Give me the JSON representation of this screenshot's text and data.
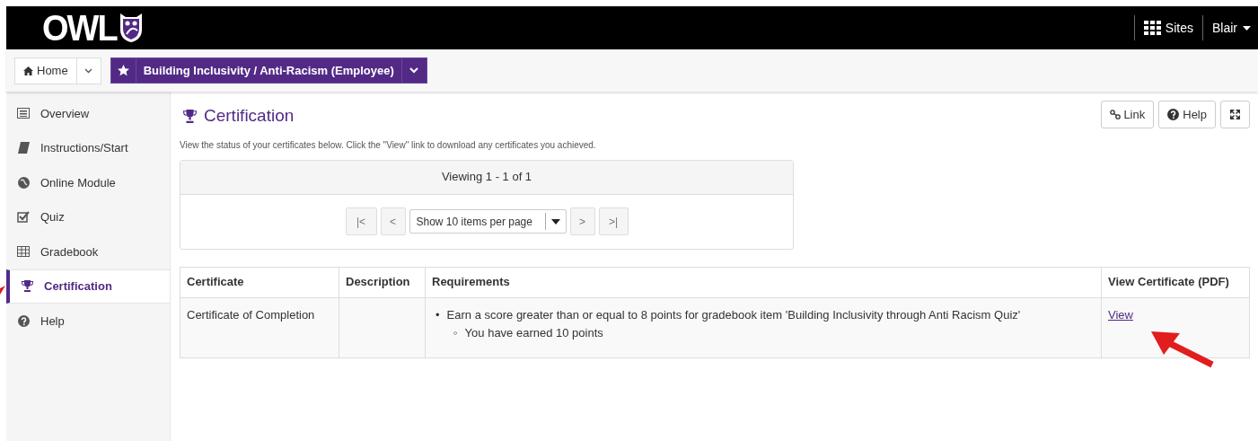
{
  "header": {
    "logo": "OWL",
    "sites": "Sites",
    "user": "Blair"
  },
  "breadcrumb": {
    "home": "Home",
    "site": "Building Inclusivity / Anti-Racism (Employee)"
  },
  "sidebar": {
    "items": [
      {
        "label": "Overview",
        "selected": false
      },
      {
        "label": "Instructions/Start",
        "selected": false
      },
      {
        "label": "Online Module",
        "selected": false
      },
      {
        "label": "Quiz",
        "selected": false
      },
      {
        "label": "Gradebook",
        "selected": false
      },
      {
        "label": "Certification",
        "selected": true
      },
      {
        "label": "Help",
        "selected": false
      }
    ]
  },
  "page": {
    "title": "Certification",
    "buttons": [
      "Link",
      "Help"
    ],
    "intro": "View the status of your certificates below. Click the \"View\" link to download any certificates you achieved."
  },
  "pager": {
    "status": "Viewing 1 - 1 of 1",
    "first": "|<",
    "prev": "<",
    "page_size": "Show 10 items per page",
    "next": ">",
    "last": ">|"
  },
  "table": {
    "columns": [
      "Certificate",
      "Description",
      "Requirements",
      "View Certificate (PDF)"
    ],
    "rows": [
      {
        "certificate": "Certificate of Completion",
        "bullet": "•",
        "requirement": "Earn a score greater than or equal to 8 points for gradebook item 'Building Inclusivity through Anti Racism Quiz'",
        "sub_bullet": "◦",
        "progress": "You have earned 10 points",
        "link": "View"
      }
    ]
  }
}
